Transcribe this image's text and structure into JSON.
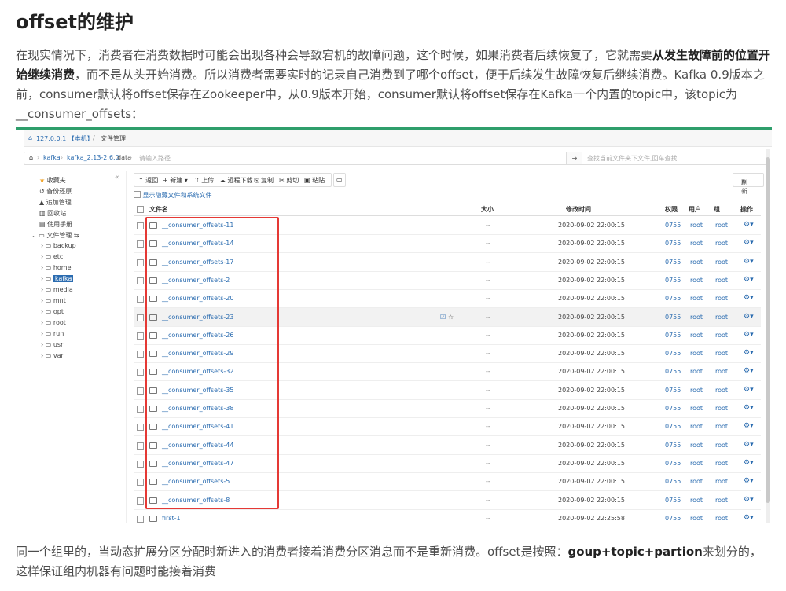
{
  "article": {
    "title": "offset的维护",
    "p1_part1": "在现实情况下，消费者在消费数据时可能会出现各种会导致宕机的故障问题，这个时候，如果消费者后续恢复了，它就需要",
    "p1_bold": "从发生故障前的位置开始继续消费",
    "p1_part2": "，而不是从头开始消费。所以消费者需要实时的记录自己消费到了哪个offset，便于后续发生故障恢复后继续消费。Kafka 0.9版本之前，consumer默认将offset保存在Zookeeper中，从0.9版本开始，consumer默认将offset保存在Kafka一个内置的topic中，该topic为 __consumer_offsets：",
    "p2_part1": "同一个组里的，当动态扩展分区分配时新进入的消费者接着消费分区消息而不是重新消费。offset是按照：",
    "p2_bold": "goup+topic+partion",
    "p2_part2": "来划分的，这样保证组内机器有问题时能接着消费"
  },
  "screenshot": {
    "topbar": {
      "host": "127.0.0.1 【本机】",
      "section": "文件管理"
    },
    "path": [
      "kafka",
      "kafka_2.13-2.6.0",
      "data"
    ],
    "path_placeholder": "请输入路径...",
    "go_label": "→",
    "search_placeholder": "查找当前文件夹下文件,回车查找",
    "sidebar": {
      "favorites": "收藏夹",
      "items": [
        "备份还原",
        "追加管理",
        "回收站",
        "使用手册"
      ],
      "file_manager": "文件管理",
      "dirs": [
        "backup",
        "etc",
        "home",
        "kafka",
        "media",
        "mnt",
        "opt",
        "root",
        "run",
        "usr",
        "var"
      ],
      "selected": "kafka"
    },
    "toolbar": {
      "back": "返回",
      "new": "新建",
      "upload": "上传",
      "remote_download": "远程下载",
      "copy": "复制",
      "cut": "剪切",
      "paste": "粘贴",
      "refresh": "刷新"
    },
    "show_hidden": "显示隐藏文件和系统文件",
    "columns": {
      "name": "文件名",
      "size": "大小",
      "mtime": "修改时间",
      "perm": "权限",
      "user": "用户",
      "group": "组",
      "ops": "操作"
    },
    "rows": [
      {
        "name": "__consumer_offsets-11",
        "size": "--",
        "mtime": "2020-09-02 22:00:15",
        "perm": "0755",
        "user": "root",
        "group": "root"
      },
      {
        "name": "__consumer_offsets-14",
        "size": "--",
        "mtime": "2020-09-02 22:00:15",
        "perm": "0755",
        "user": "root",
        "group": "root"
      },
      {
        "name": "__consumer_offsets-17",
        "size": "--",
        "mtime": "2020-09-02 22:00:15",
        "perm": "0755",
        "user": "root",
        "group": "root"
      },
      {
        "name": "__consumer_offsets-2",
        "size": "--",
        "mtime": "2020-09-02 22:00:15",
        "perm": "0755",
        "user": "root",
        "group": "root"
      },
      {
        "name": "__consumer_offsets-20",
        "size": "--",
        "mtime": "2020-09-02 22:00:15",
        "perm": "0755",
        "user": "root",
        "group": "root"
      },
      {
        "name": "__consumer_offsets-23",
        "size": "--",
        "mtime": "2020-09-02 22:00:15",
        "perm": "0755",
        "user": "root",
        "group": "root"
      },
      {
        "name": "__consumer_offsets-26",
        "size": "--",
        "mtime": "2020-09-02 22:00:15",
        "perm": "0755",
        "user": "root",
        "group": "root"
      },
      {
        "name": "__consumer_offsets-29",
        "size": "--",
        "mtime": "2020-09-02 22:00:15",
        "perm": "0755",
        "user": "root",
        "group": "root"
      },
      {
        "name": "__consumer_offsets-32",
        "size": "--",
        "mtime": "2020-09-02 22:00:15",
        "perm": "0755",
        "user": "root",
        "group": "root"
      },
      {
        "name": "__consumer_offsets-35",
        "size": "--",
        "mtime": "2020-09-02 22:00:15",
        "perm": "0755",
        "user": "root",
        "group": "root"
      },
      {
        "name": "__consumer_offsets-38",
        "size": "--",
        "mtime": "2020-09-02 22:00:15",
        "perm": "0755",
        "user": "root",
        "group": "root"
      },
      {
        "name": "__consumer_offsets-41",
        "size": "--",
        "mtime": "2020-09-02 22:00:15",
        "perm": "0755",
        "user": "root",
        "group": "root"
      },
      {
        "name": "__consumer_offsets-44",
        "size": "--",
        "mtime": "2020-09-02 22:00:15",
        "perm": "0755",
        "user": "root",
        "group": "root"
      },
      {
        "name": "__consumer_offsets-47",
        "size": "--",
        "mtime": "2020-09-02 22:00:15",
        "perm": "0755",
        "user": "root",
        "group": "root"
      },
      {
        "name": "__consumer_offsets-5",
        "size": "--",
        "mtime": "2020-09-02 22:00:15",
        "perm": "0755",
        "user": "root",
        "group": "root"
      },
      {
        "name": "__consumer_offsets-8",
        "size": "--",
        "mtime": "2020-09-02 22:00:15",
        "perm": "0755",
        "user": "root",
        "group": "root"
      },
      {
        "name": "first-1",
        "size": "--",
        "mtime": "2020-09-02 22:25:58",
        "perm": "0755",
        "user": "root",
        "group": "root"
      }
    ],
    "highlighted_row": "__consumer_offsets-23",
    "colors": {
      "link": "#2b6cb0",
      "highlight_box": "#e53935",
      "divider": "#2e9e6b"
    }
  }
}
